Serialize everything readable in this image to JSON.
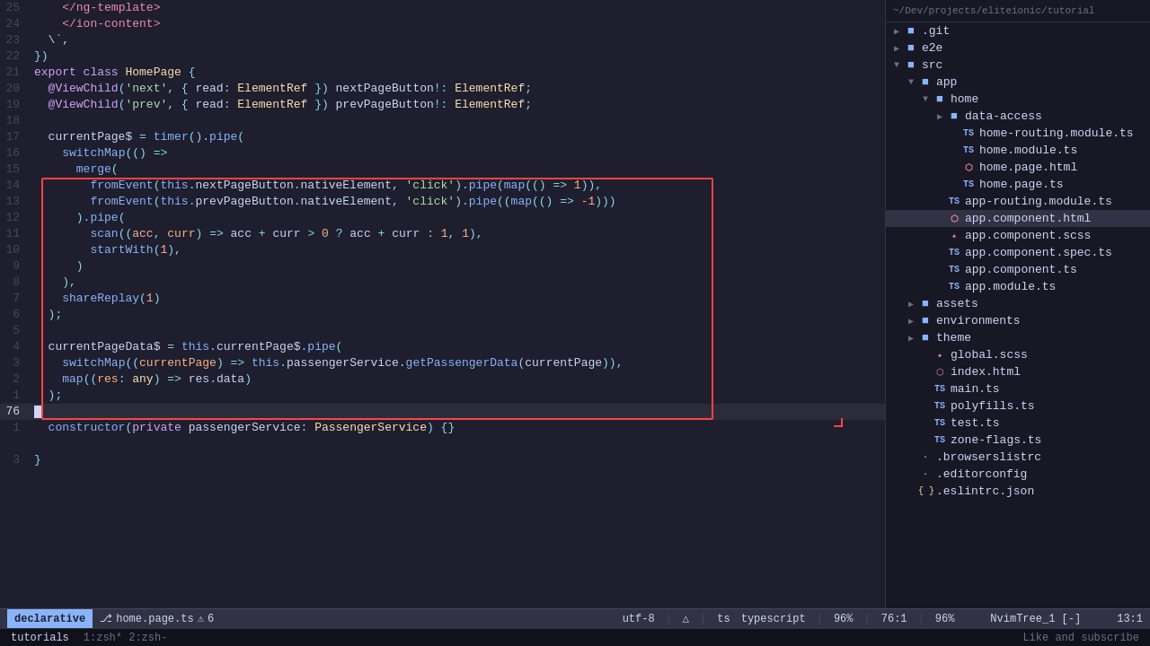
{
  "sidebar": {
    "path": "~/Dev/projects/eliteionic/tutorial",
    "tree": [
      {
        "id": "git",
        "label": ".git",
        "type": "folder",
        "indent": 0,
        "expanded": false
      },
      {
        "id": "e2e",
        "label": "e2e",
        "type": "folder",
        "indent": 0,
        "expanded": false
      },
      {
        "id": "src",
        "label": "src",
        "type": "folder",
        "indent": 0,
        "expanded": true
      },
      {
        "id": "app",
        "label": "app",
        "type": "folder",
        "indent": 1,
        "expanded": true
      },
      {
        "id": "home",
        "label": "home",
        "type": "folder",
        "indent": 2,
        "expanded": true
      },
      {
        "id": "data-access",
        "label": "data-access",
        "type": "folder",
        "indent": 3,
        "expanded": false
      },
      {
        "id": "home-routing",
        "label": "home-routing.module.ts",
        "type": "ts",
        "indent": 3
      },
      {
        "id": "home-module",
        "label": "home.module.ts",
        "type": "ts",
        "indent": 3
      },
      {
        "id": "home-page-html",
        "label": "home.page.html",
        "type": "html",
        "indent": 3
      },
      {
        "id": "home-page-ts",
        "label": "home.page.ts",
        "type": "ts",
        "indent": 3
      },
      {
        "id": "app-routing",
        "label": "app-routing.module.ts",
        "type": "ts",
        "indent": 2
      },
      {
        "id": "app-component-html",
        "label": "app.component.html",
        "type": "html",
        "indent": 2,
        "active": true
      },
      {
        "id": "app-component-scss",
        "label": "app.component.scss",
        "type": "scss",
        "indent": 2
      },
      {
        "id": "app-component-spec",
        "label": "app.component.spec.ts",
        "type": "spec",
        "indent": 2
      },
      {
        "id": "app-component-ts",
        "label": "app.component.ts",
        "type": "ts",
        "indent": 2
      },
      {
        "id": "app-module",
        "label": "app.module.ts",
        "type": "ts",
        "indent": 2
      },
      {
        "id": "assets",
        "label": "assets",
        "type": "folder",
        "indent": 1,
        "expanded": false
      },
      {
        "id": "environments",
        "label": "environments",
        "type": "folder",
        "indent": 1,
        "expanded": false
      },
      {
        "id": "theme",
        "label": "theme",
        "type": "folder",
        "indent": 1,
        "expanded": false
      },
      {
        "id": "global-scss",
        "label": "global.scss",
        "type": "scss",
        "indent": 1
      },
      {
        "id": "index-html",
        "label": "index.html",
        "type": "html",
        "indent": 1
      },
      {
        "id": "main-ts",
        "label": "main.ts",
        "type": "ts",
        "indent": 1
      },
      {
        "id": "polyfills-ts",
        "label": "polyfills.ts",
        "type": "ts",
        "indent": 1
      },
      {
        "id": "test-ts",
        "label": "test.ts",
        "type": "ts",
        "indent": 1
      },
      {
        "id": "zone-flags-ts",
        "label": "zone-flags.ts",
        "type": "ts",
        "indent": 1
      },
      {
        "id": "browserslist",
        "label": ".browserslistrc",
        "type": "file",
        "indent": 0
      },
      {
        "id": "editorconfig",
        "label": ".editorconfig",
        "type": "file",
        "indent": 0
      },
      {
        "id": "eslintrc",
        "label": ".eslintrc.json",
        "type": "json",
        "indent": 0
      }
    ]
  },
  "editor": {
    "lines": [
      {
        "num": "25",
        "content": "    </ng-template>"
      },
      {
        "num": "24",
        "content": "    </ion-content>"
      },
      {
        "num": "23",
        "content": "  `,"
      },
      {
        "num": "22",
        "content": "})"
      },
      {
        "num": "21",
        "content": "export class HomePage {"
      },
      {
        "num": "20",
        "content": "  @ViewChild('next', { read: ElementRef }) nextPageButton!: ElementRef;"
      },
      {
        "num": "19",
        "content": "  @ViewChild('prev', { read: ElementRef }) prevPageButton!: ElementRef;"
      },
      {
        "num": "18",
        "content": ""
      },
      {
        "num": "17",
        "content": "  currentPage$ = timer().pipe("
      },
      {
        "num": "16",
        "content": "    switchMap(() =>"
      },
      {
        "num": "15",
        "content": "      merge("
      },
      {
        "num": "14",
        "content": "        fromEvent(this.nextPageButton.nativeElement, 'click').pipe(map(() => 1)),"
      },
      {
        "num": "13",
        "content": "        fromEvent(this.prevPageButton.nativeElement, 'click').pipe((map(() => -1)))"
      },
      {
        "num": "12",
        "content": "      ).pipe("
      },
      {
        "num": "11",
        "content": "        scan((acc, curr) => acc + curr > 0 ? acc + curr : 1, 1),"
      },
      {
        "num": "10",
        "content": "        startWith(1),"
      },
      {
        "num": "9",
        "content": "      )"
      },
      {
        "num": "8",
        "content": "    ),"
      },
      {
        "num": "7",
        "content": "    shareReplay(1)"
      },
      {
        "num": "6",
        "content": "  );"
      },
      {
        "num": "5",
        "content": ""
      },
      {
        "num": "4",
        "content": "  currentPageData$ = this.currentPage$.pipe("
      },
      {
        "num": "3",
        "content": "    switchMap((currentPage) => this.passengerService.getPassengerData(currentPage)),"
      },
      {
        "num": "2",
        "content": "    map((res: any) => res.data)"
      },
      {
        "num": "1",
        "content": "  );"
      },
      {
        "num": "76",
        "content": "",
        "cursor": true
      },
      {
        "num": "1",
        "content": "  constructor(private passengerService: PassengerService) {}"
      },
      {
        "num": "",
        "content": ""
      },
      {
        "num": "3",
        "content": "}"
      }
    ]
  },
  "statusbar": {
    "mode": "declarative",
    "file": "home.page.ts",
    "errors": "6",
    "encoding": "utf-8",
    "git": "",
    "filetype": "typescript",
    "zoom": "96%",
    "position": "76:1",
    "zoom2": "96%",
    "nvim": "NvimTree_1 [-]",
    "col": "13:1"
  },
  "terminal": {
    "tab1": "tutorials",
    "content1": "1:zsh*  2:zsh-",
    "like": "Like and subscribe"
  }
}
